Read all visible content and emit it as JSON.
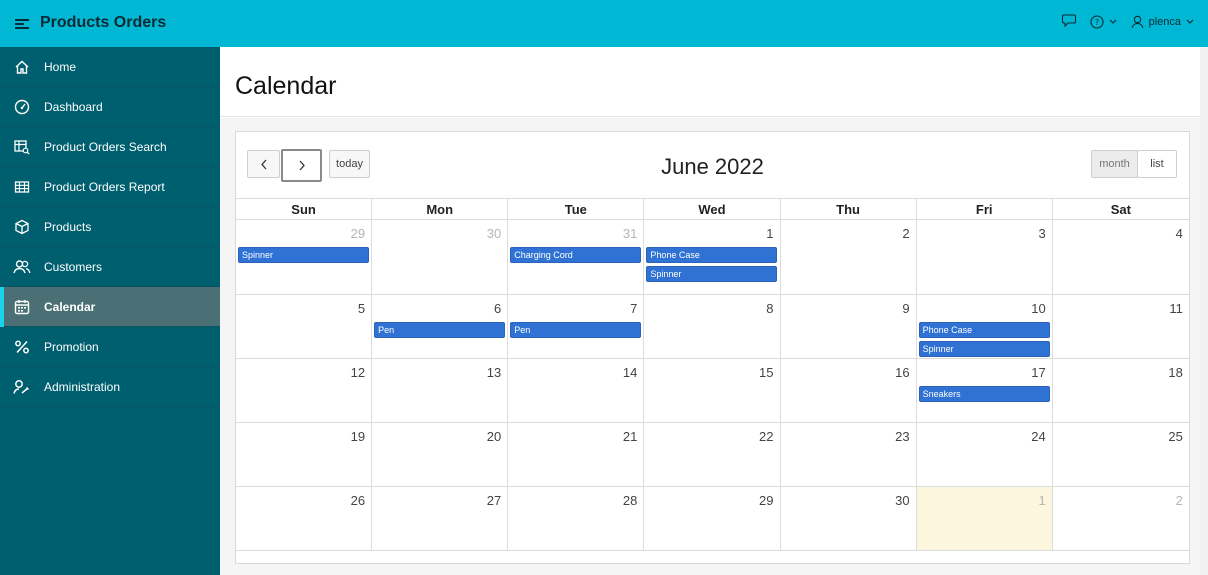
{
  "app": {
    "title": "Products Orders",
    "user": "plenca"
  },
  "nav": [
    {
      "label": "Home",
      "icon": "home-icon"
    },
    {
      "label": "Dashboard",
      "icon": "gauge-icon"
    },
    {
      "label": "Product Orders Search",
      "icon": "table-search-icon"
    },
    {
      "label": "Product Orders Report",
      "icon": "table-icon"
    },
    {
      "label": "Products",
      "icon": "box-icon"
    },
    {
      "label": "Customers",
      "icon": "users-icon"
    },
    {
      "label": "Calendar",
      "icon": "calendar-icon",
      "active": true
    },
    {
      "label": "Promotion",
      "icon": "percent-icon"
    },
    {
      "label": "Administration",
      "icon": "user-wrench-icon"
    }
  ],
  "page": {
    "title": "Calendar"
  },
  "calendar": {
    "title": "June 2022",
    "prev_label": "‹",
    "next_label": "›",
    "today_label": "today",
    "month_label": "month",
    "list_label": "list",
    "dow": [
      "Sun",
      "Mon",
      "Tue",
      "Wed",
      "Thu",
      "Fri",
      "Sat"
    ],
    "weeks": [
      [
        {
          "n": "29",
          "other": true,
          "events": [
            "Spinner"
          ]
        },
        {
          "n": "30",
          "other": true,
          "events": []
        },
        {
          "n": "31",
          "other": true,
          "events": [
            "Charging Cord"
          ]
        },
        {
          "n": "1",
          "events": [
            "Phone Case",
            "Spinner"
          ]
        },
        {
          "n": "2",
          "events": []
        },
        {
          "n": "3",
          "events": []
        },
        {
          "n": "4",
          "events": []
        }
      ],
      [
        {
          "n": "5",
          "events": []
        },
        {
          "n": "6",
          "events": [
            "Pen"
          ]
        },
        {
          "n": "7",
          "events": [
            "Pen"
          ]
        },
        {
          "n": "8",
          "events": []
        },
        {
          "n": "9",
          "events": []
        },
        {
          "n": "10",
          "events": [
            "Phone Case",
            "Spinner"
          ]
        },
        {
          "n": "11",
          "events": []
        }
      ],
      [
        {
          "n": "12",
          "events": []
        },
        {
          "n": "13",
          "events": []
        },
        {
          "n": "14",
          "events": []
        },
        {
          "n": "15",
          "events": []
        },
        {
          "n": "16",
          "events": []
        },
        {
          "n": "17",
          "events": [
            "Sneakers"
          ]
        },
        {
          "n": "18",
          "events": []
        }
      ],
      [
        {
          "n": "19",
          "events": []
        },
        {
          "n": "20",
          "events": []
        },
        {
          "n": "21",
          "events": []
        },
        {
          "n": "22",
          "events": []
        },
        {
          "n": "23",
          "events": []
        },
        {
          "n": "24",
          "events": []
        },
        {
          "n": "25",
          "events": []
        }
      ],
      [
        {
          "n": "26",
          "events": []
        },
        {
          "n": "27",
          "events": []
        },
        {
          "n": "28",
          "events": []
        },
        {
          "n": "29",
          "events": []
        },
        {
          "n": "30",
          "events": []
        },
        {
          "n": "1",
          "other": true,
          "today": true,
          "events": []
        },
        {
          "n": "2",
          "other": true,
          "events": []
        }
      ]
    ]
  },
  "colors": {
    "topbar": "#00b8d4",
    "sidebar": "#005f6e",
    "event": "#2f72d3",
    "today_bg": "#fcf6de"
  }
}
